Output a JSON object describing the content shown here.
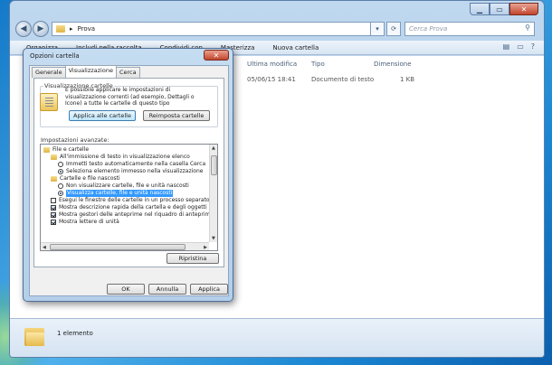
{
  "explorer": {
    "address": [
      "Prova"
    ],
    "search_placeholder": "Cerca Prova",
    "toolbar": [
      "Organizza",
      "Includi nella raccolta",
      "Condividi con",
      "Masterizza",
      "Nuova cartella"
    ],
    "columns": [
      "Ultima modifica",
      "Tipo",
      "Dimensione"
    ],
    "file": {
      "modified": "05/06/15 18:41",
      "type": "Documento di testo",
      "size": "1 KB"
    },
    "status": "1 elemento"
  },
  "dialog": {
    "title": "Opzioni cartella",
    "tabs": [
      "Generale",
      "Visualizzazione",
      "Cerca"
    ],
    "group_title": "Visualizzazione cartelle",
    "group_text": "È possibile applicare le impostazioni di visualizzazione correnti (ad esempio, Dettagli o Icone) a tutte le cartelle di questo tipo",
    "apply_folders": "Applica alle cartelle",
    "reset_folders": "Reimposta cartelle",
    "advanced_label": "Impostazioni avanzate:",
    "tree": [
      {
        "kind": "folder",
        "label": "File e cartelle"
      },
      {
        "kind": "folder",
        "label": "All'immissione di testo in visualizzazione elenco"
      },
      {
        "kind": "radio",
        "checked": false,
        "label": "Immetti testo automaticamente nella casella Cerca"
      },
      {
        "kind": "radio",
        "checked": true,
        "label": "Seleziona elemento immesso nella visualizzazione"
      },
      {
        "kind": "folder",
        "label": "Cartelle e file nascosti"
      },
      {
        "kind": "radio",
        "checked": false,
        "label": "Non visualizzare cartelle, file e unità nascosti"
      },
      {
        "kind": "radio",
        "checked": true,
        "label": "Visualizza cartelle, file e unità nascosti"
      },
      {
        "kind": "check",
        "checked": false,
        "label": "Esegui le finestre delle cartelle in un processo separato"
      },
      {
        "kind": "check",
        "checked": true,
        "label": "Mostra descrizione rapida della cartella e degli oggetti del"
      },
      {
        "kind": "check",
        "checked": true,
        "label": "Mostra gestori delle anteprime nel riquadro di anteprima"
      },
      {
        "kind": "check",
        "checked": true,
        "label": "Mostra lettere di unità"
      }
    ],
    "restore": "Ripristina",
    "ok": "OK",
    "cancel": "Annulla",
    "apply": "Applica"
  }
}
